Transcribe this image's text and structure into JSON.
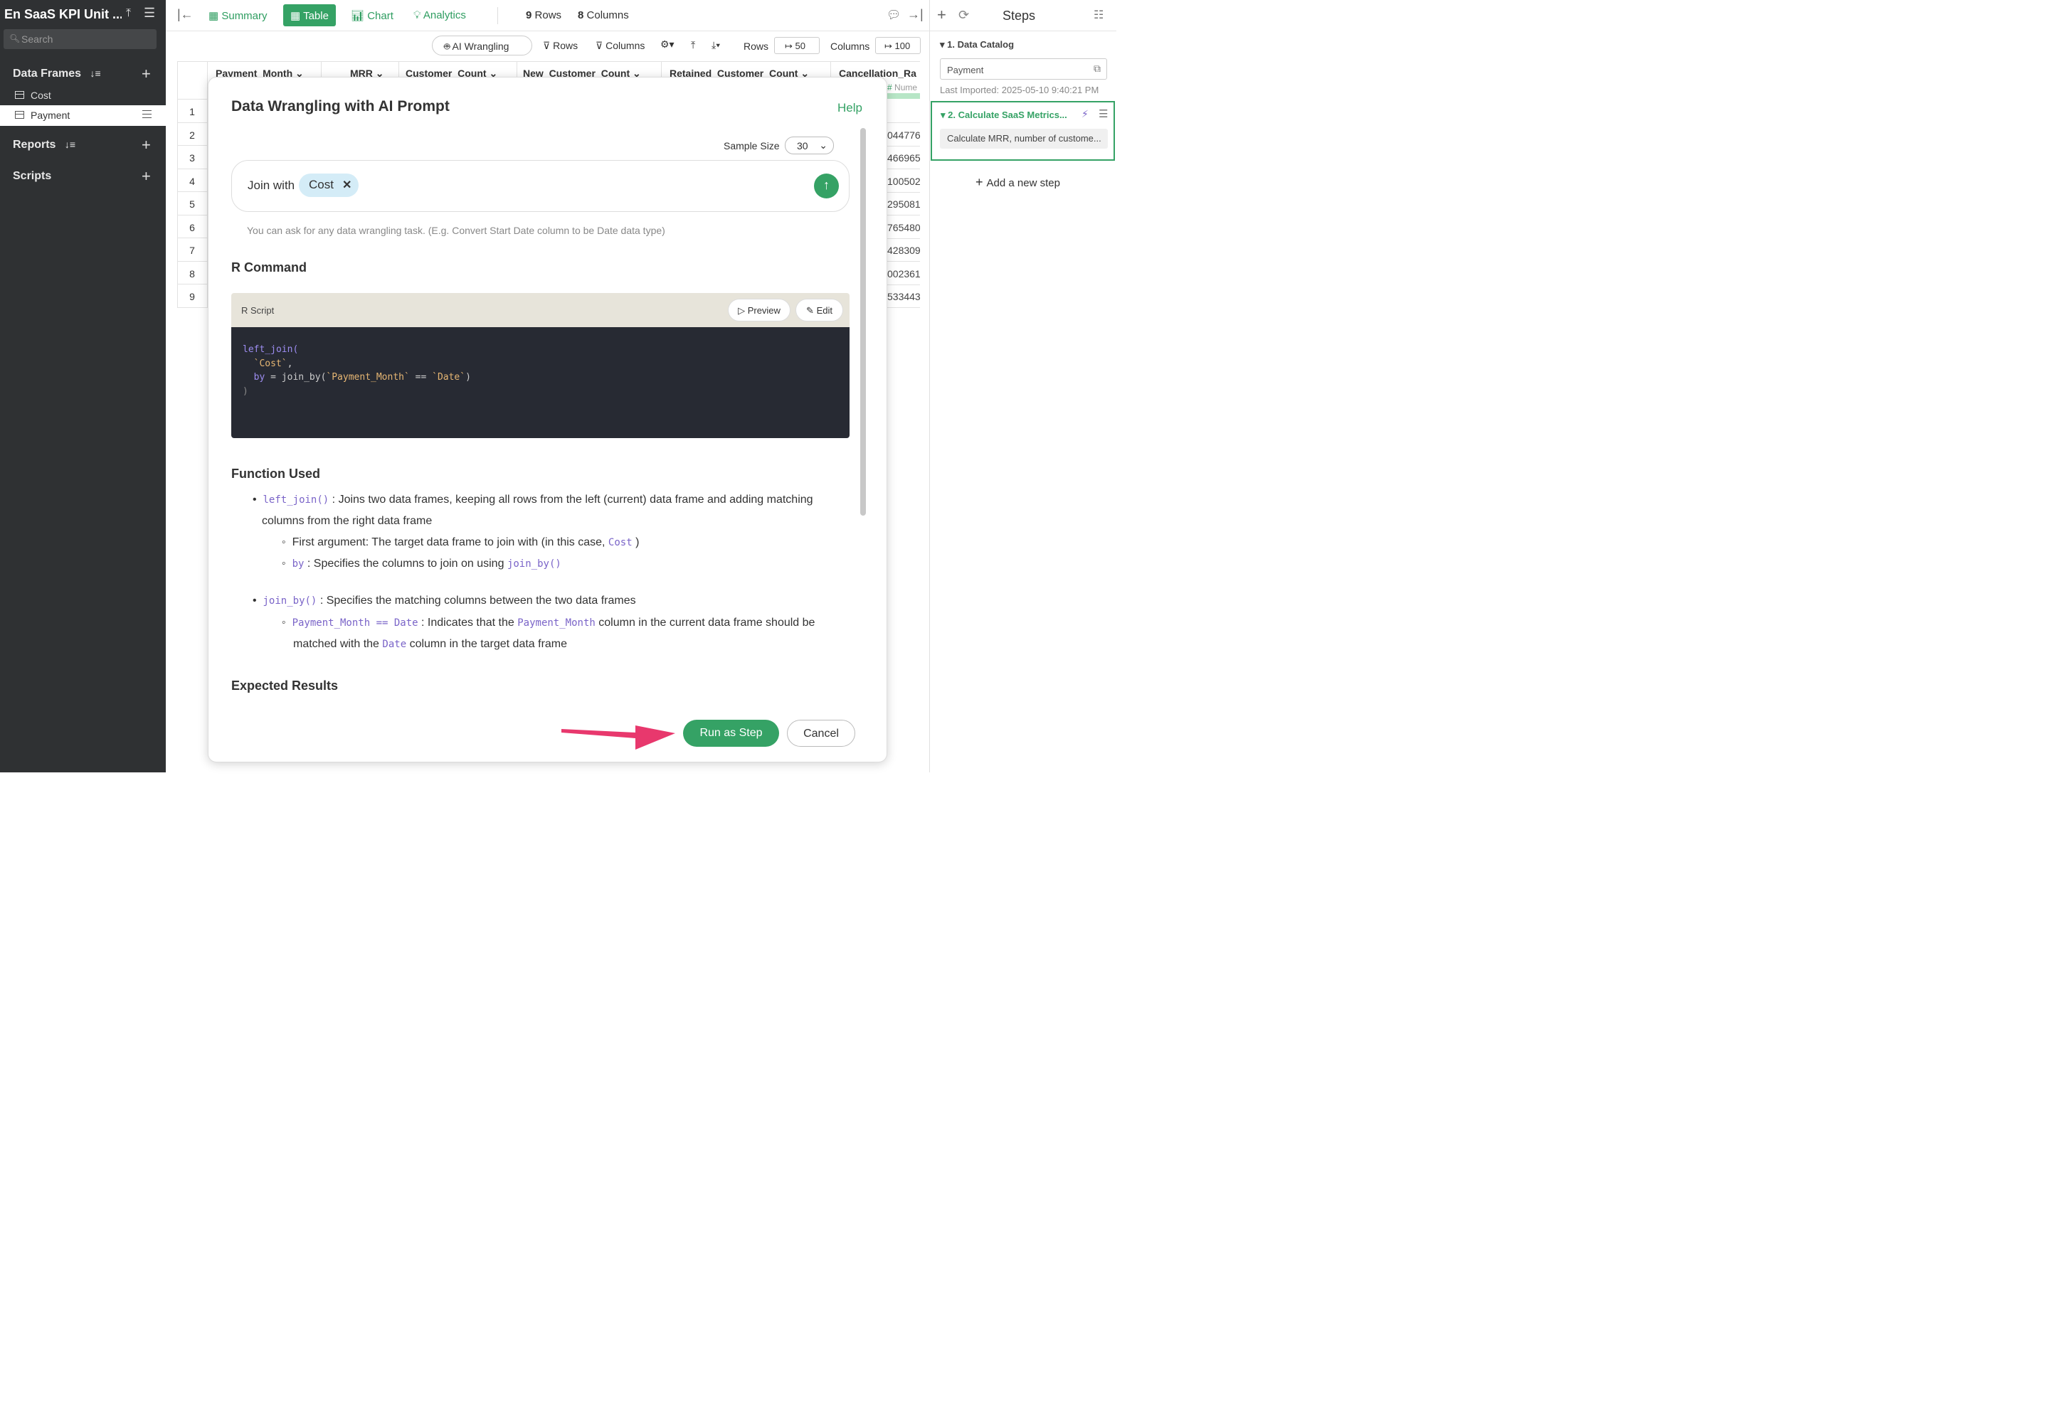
{
  "sidebar": {
    "title": "En SaaS KPI Unit ...",
    "search_placeholder": "Search",
    "data_frames_label": "Data Frames",
    "frames": [
      "Cost",
      "Payment"
    ],
    "reports_label": "Reports",
    "scripts_label": "Scripts"
  },
  "topbar": {
    "tabs": [
      "Summary",
      "Table",
      "Chart",
      "Analytics"
    ],
    "rows_count": "9",
    "rows_label": "Rows",
    "cols_count": "8",
    "cols_label": "Columns"
  },
  "toolbar": {
    "ai_wrangling": "AI Wrangling",
    "rows_filter": "Rows",
    "columns_filter": "Columns",
    "rows_label": "Rows",
    "rows_value": "50",
    "columns_label": "Columns",
    "columns_value": "100"
  },
  "table": {
    "headers": [
      "Payment_Month",
      "MRR",
      "Customer_Count",
      "New_Customer_Count",
      "Retained_Customer_Count",
      "Cancellation_Ra"
    ],
    "type_tag": "Nume",
    "row_numbers": [
      "1",
      "2",
      "3",
      "4",
      "5",
      "6",
      "7",
      "8",
      "9"
    ],
    "last_col_values": [
      "",
      "044776",
      "466965",
      "100502",
      "295081",
      "765480",
      "428309",
      "002361",
      "533443"
    ]
  },
  "steps": {
    "title": "Steps",
    "step1_label": "1. Data Catalog",
    "step1_source": "Payment",
    "step1_imported": "Last Imported: 2025-05-10 9:40:21 PM",
    "step2_label": "2. Calculate SaaS Metrics...",
    "step2_desc": "Calculate MRR, number of custome...",
    "add_step": "Add a new step"
  },
  "modal": {
    "title": "Data Wrangling with AI Prompt",
    "help": "Help",
    "sample_size_label": "Sample Size",
    "sample_size_value": "30",
    "prompt_text": "Join with",
    "prompt_chip": "Cost",
    "hint": "You can ask for any data wrangling task. (E.g. Convert Start Date column to be Date data type)",
    "r_command_heading": "R Command",
    "r_script_label": "R Script",
    "preview_label": "Preview",
    "edit_label": "Edit",
    "code": {
      "line1": "left_join(",
      "line2": "`Cost`",
      "line3_by": "by",
      "line3_eq": " = join_by(",
      "line3_a": "`Payment_Month`",
      "line3_op": " == ",
      "line3_b": "`Date`",
      "line4": ")"
    },
    "function_used_heading": "Function Used",
    "fn1_name": "left_join()",
    "fn1_desc": ": Joins two data frames, keeping all rows from the left (current) data frame and adding matching",
    "fn1_desc2": "columns from the right data frame",
    "fn1_sub1": "First argument: The target data frame to join with (in this case,",
    "fn1_sub1_code": "Cost",
    "fn1_sub2_code": "by",
    "fn1_sub2": ": Specifies the columns to join on using",
    "fn1_sub2_code2": "join_by()",
    "fn2_name": "join_by()",
    "fn2_desc": ": Specifies the matching columns between the two data frames",
    "fn2_sub1_code": "Payment_Month == Date",
    "fn2_sub1": ": Indicates that the",
    "fn2_sub1_code2": "Payment_Month",
    "fn2_sub1_b": "column in the current data frame should be",
    "fn2_sub1_c": "matched with the",
    "fn2_sub1_code3": "Date",
    "fn2_sub1_d": "column in the target data frame",
    "expected_heading": "Expected Results",
    "run_button": "Run as Step",
    "cancel_button": "Cancel"
  },
  "colors": {
    "accent": "#35a265",
    "sidebar_bg": "#2f3133",
    "arrow": "#e8386d",
    "code_bg": "#272a33"
  }
}
